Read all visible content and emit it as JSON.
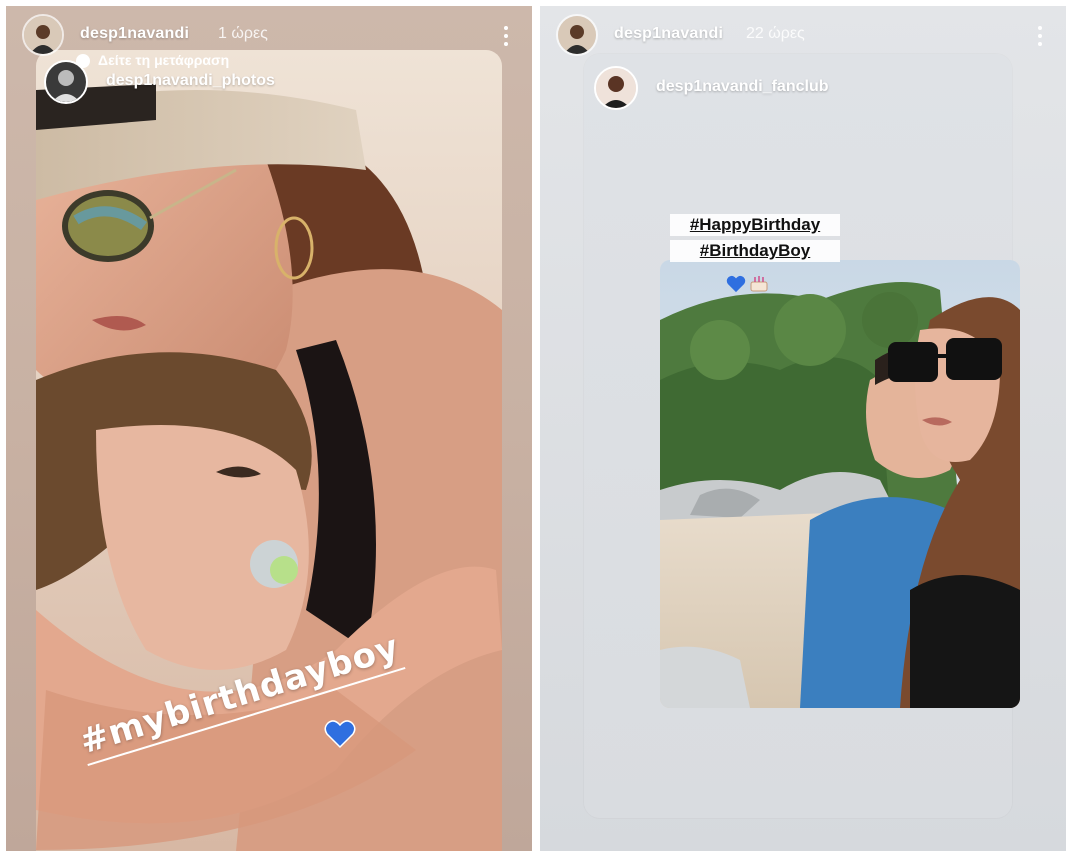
{
  "left_story": {
    "username": "desp1navandi",
    "time": "1 ώρες",
    "translate_label": "Δείτε τη μετάφραση",
    "shared_account": "desp1navandi_photos",
    "hashtag": "#mybirthdayboy"
  },
  "right_story": {
    "username": "desp1navandi",
    "time": "22 ώρες",
    "shared_account": "desp1navandi_fanclub",
    "hashtags": [
      "#HappyBirthday",
      "#BirthdayBoy"
    ]
  },
  "colors": {
    "heart": "#2f6fe0",
    "left_bg": "#c8b1a3",
    "right_bg": "#d6d9dd"
  },
  "icons": [
    "more-icon",
    "translate-icon",
    "heart-icon",
    "cake-icon"
  ]
}
